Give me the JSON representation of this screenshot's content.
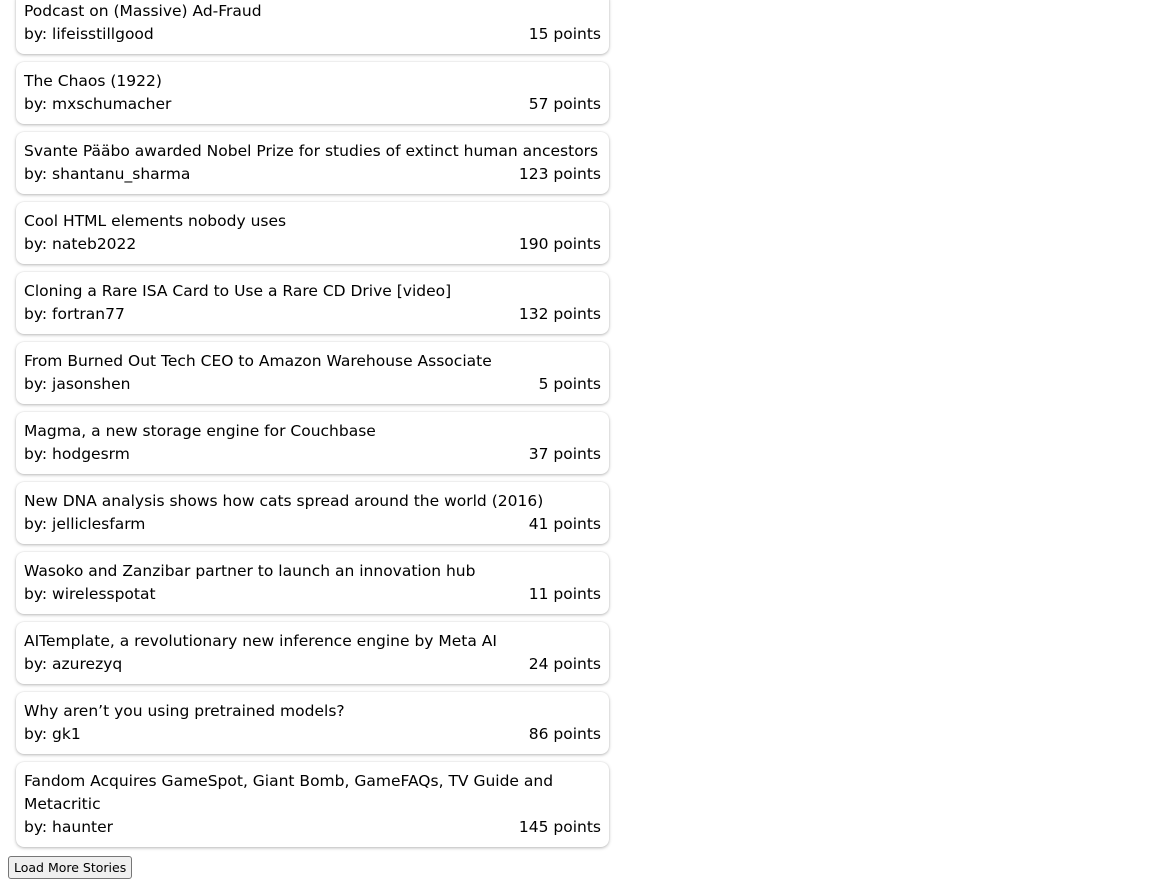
{
  "stories": [
    {
      "title": "Podcast on (Massive) Ad-Fraud",
      "author": "lifeisstillgood",
      "points": "15"
    },
    {
      "title": "The Chaos (1922)",
      "author": "mxschumacher",
      "points": "57"
    },
    {
      "title": "Svante Pääbo awarded Nobel Prize for studies of extinct human ancestors",
      "author": "shantanu_sharma",
      "points": "123"
    },
    {
      "title": "Cool HTML elements nobody uses",
      "author": "nateb2022",
      "points": "190"
    },
    {
      "title": "Cloning a Rare ISA Card to Use a Rare CD Drive [video]",
      "author": "fortran77",
      "points": "132"
    },
    {
      "title": "From Burned Out Tech CEO to Amazon Warehouse Associate",
      "author": "jasonshen",
      "points": "5"
    },
    {
      "title": "Magma, a new storage engine for Couchbase",
      "author": "hodgesrm",
      "points": "37"
    },
    {
      "title": "New DNA analysis shows how cats spread around the world (2016)",
      "author": "jelliclesfarm",
      "points": "41"
    },
    {
      "title": "Wasoko and Zanzibar partner to launch an innovation hub",
      "author": "wirelesspotat",
      "points": "11"
    },
    {
      "title": "AITemplate, a revolutionary new inference engine by Meta AI",
      "author": "azurezyq",
      "points": "24"
    },
    {
      "title": "Why aren’t you using pretrained models?",
      "author": "gk1",
      "points": "86"
    },
    {
      "title": "Fandom Acquires GameSpot, Giant Bomb, GameFAQs, TV Guide and Metacritic",
      "author": "haunter",
      "points": "145"
    }
  ],
  "labels": {
    "by_prefix": "by:",
    "points_suffix": "points",
    "load_more": "Load More Stories"
  }
}
